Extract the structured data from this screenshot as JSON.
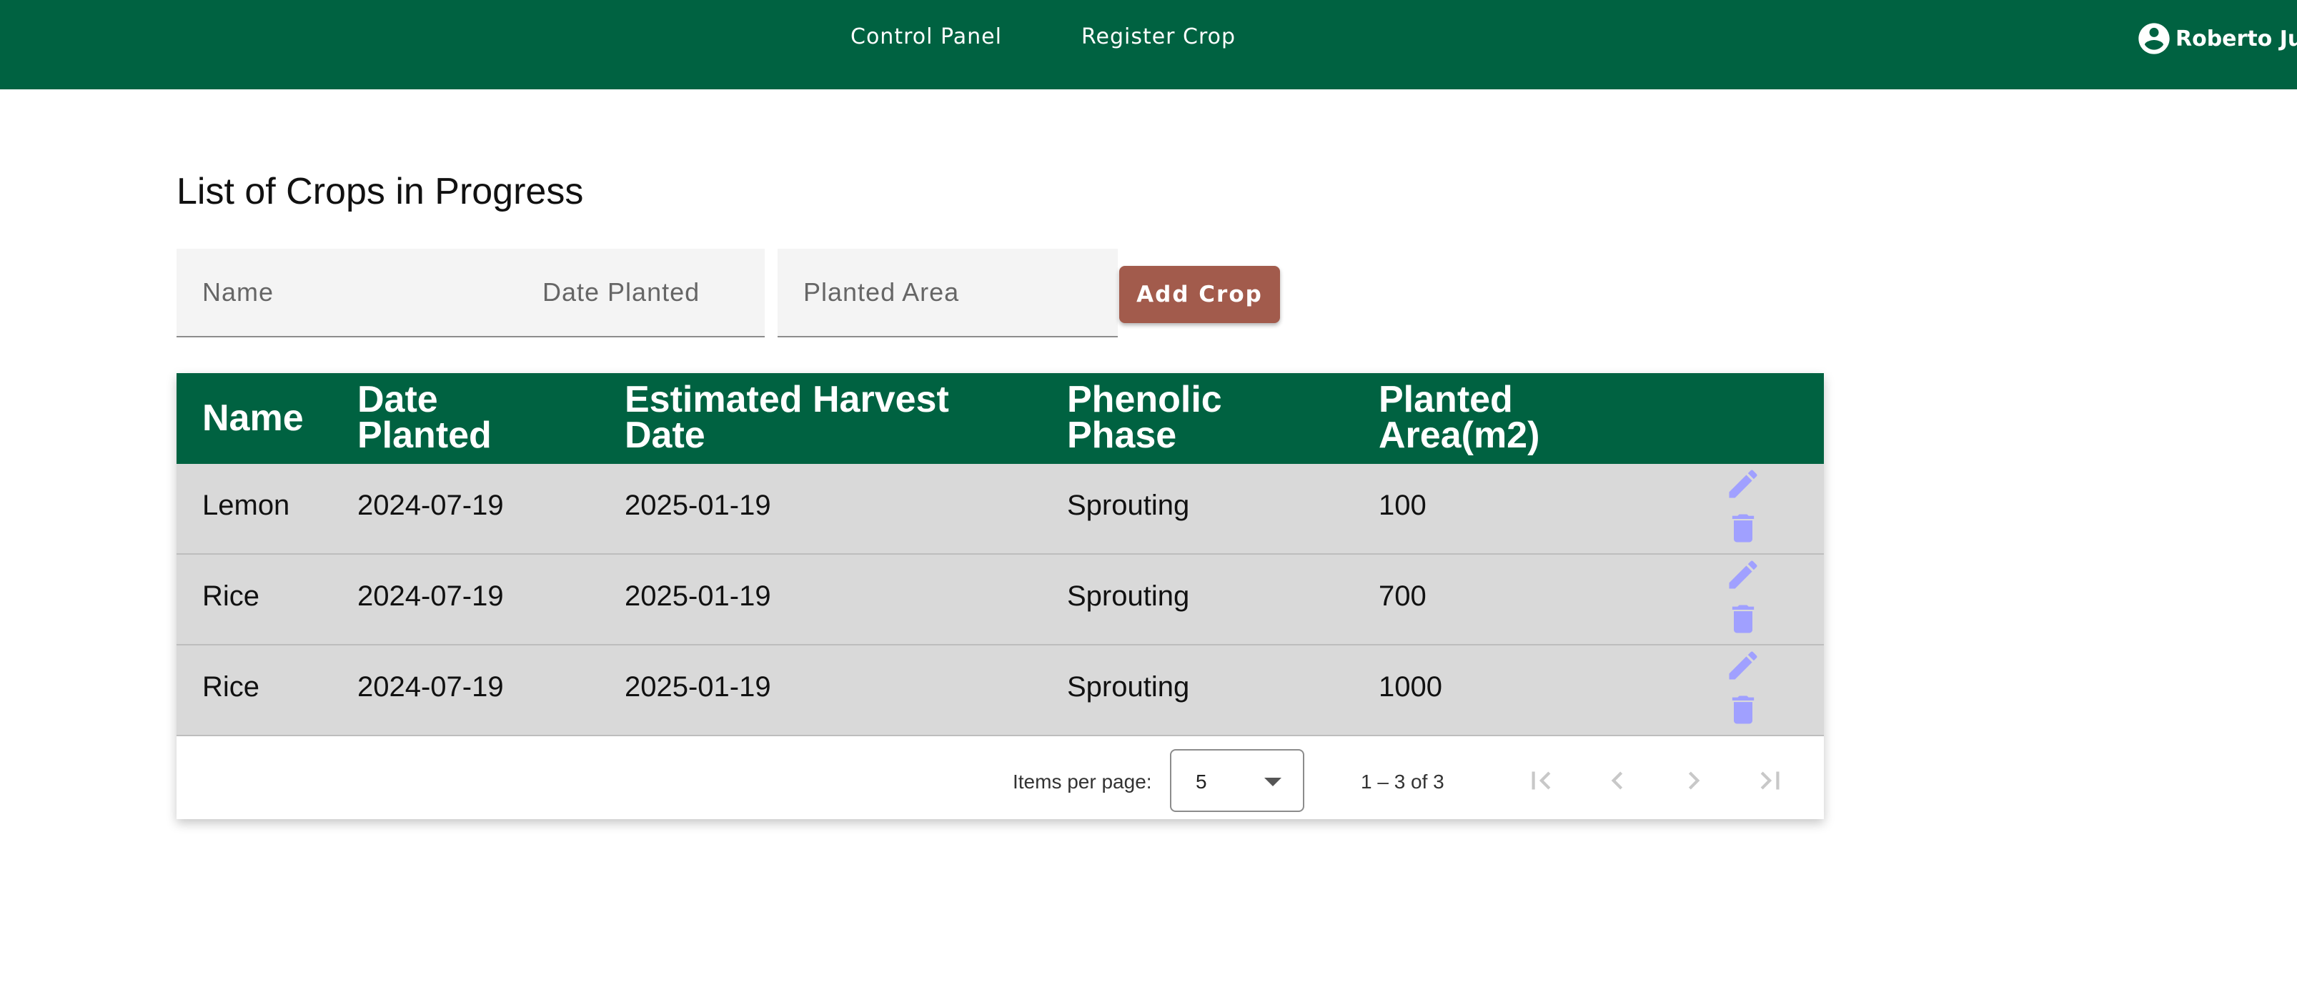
{
  "nav": {
    "control_panel": "Control Panel",
    "register_crop": "Register Crop",
    "user_name": "Roberto Juan"
  },
  "page": {
    "title": "List of Crops in Progress"
  },
  "form": {
    "name_placeholder": "Name",
    "date_placeholder": "Date Planted",
    "area_placeholder": "Planted Area",
    "add_button": "Add Crop"
  },
  "table": {
    "headers": {
      "name": "Name",
      "date_planted_1": "Date",
      "date_planted_2": "Planted",
      "harvest_1": "Estimated Harvest",
      "harvest_2": "Date",
      "phase_1": "Phenolic",
      "phase_2": "Phase",
      "area_1": "Planted",
      "area_2": "Area(m2)"
    },
    "rows": [
      {
        "name": "Lemon",
        "date_planted": "2024-07-19",
        "harvest": "2025-01-19",
        "phase": "Sprouting",
        "area": "100"
      },
      {
        "name": "Rice",
        "date_planted": "2024-07-19",
        "harvest": "2025-01-19",
        "phase": "Sprouting",
        "area": "700"
      },
      {
        "name": "Rice",
        "date_planted": "2024-07-19",
        "harvest": "2025-01-19",
        "phase": "Sprouting",
        "area": "1000"
      }
    ]
  },
  "paginator": {
    "items_per_page_label": "Items per page:",
    "page_size": "5",
    "range": "1 – 3 of 3"
  },
  "colors": {
    "header_green": "#006241",
    "add_button": "#a25b4c",
    "row_bg": "#d9d9d9",
    "action_icon": "#a0a0ff"
  },
  "icons": {
    "user": "account-circle-icon",
    "edit": "pencil-icon",
    "delete": "trash-icon",
    "first": "first-page-icon",
    "prev": "chevron-left-icon",
    "next": "chevron-right-icon",
    "last": "last-page-icon"
  }
}
